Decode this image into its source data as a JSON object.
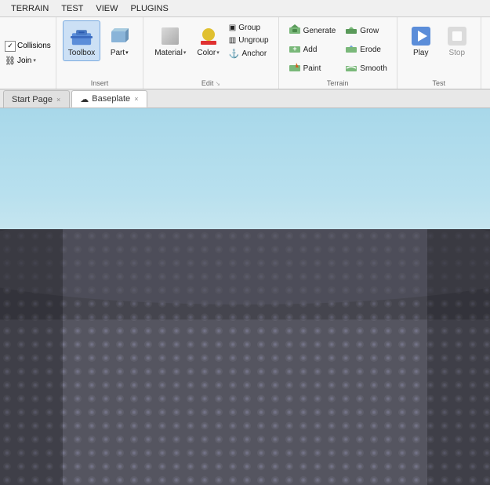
{
  "menubar": {
    "items": [
      "TERRAIN",
      "TEST",
      "VIEW",
      "PLUGINS"
    ]
  },
  "ribbon": {
    "sections": {
      "model": {
        "label": "",
        "items": [
          {
            "id": "collisions",
            "label": "Collisions",
            "type": "small-check"
          },
          {
            "id": "join",
            "label": "Join",
            "type": "small-dropdown"
          }
        ]
      },
      "insert": {
        "label": "Insert",
        "items": [
          {
            "id": "toolbox",
            "label": "Toolbox",
            "type": "large",
            "active": true
          },
          {
            "id": "part",
            "label": "Part",
            "type": "large"
          }
        ]
      },
      "edit": {
        "label": "Edit",
        "items": [
          {
            "id": "material",
            "label": "Material",
            "type": "large-dropdown"
          },
          {
            "id": "color",
            "label": "Color",
            "type": "large-dropdown"
          },
          {
            "id": "group",
            "label": "Group",
            "type": "small"
          },
          {
            "id": "ungroup",
            "label": "Ungroup",
            "type": "small"
          },
          {
            "id": "anchor",
            "label": "Anchor",
            "type": "small"
          }
        ]
      },
      "terrain": {
        "label": "Terrain",
        "items": [
          {
            "id": "generate",
            "label": "Generate",
            "type": "small-icon"
          },
          {
            "id": "add",
            "label": "Add",
            "type": "small-icon"
          },
          {
            "id": "paint",
            "label": "Paint",
            "type": "small-icon"
          },
          {
            "id": "grow",
            "label": "Grow",
            "type": "small-icon"
          },
          {
            "id": "erode",
            "label": "Erode",
            "type": "small-icon"
          },
          {
            "id": "smooth",
            "label": "Smooth",
            "type": "small-icon"
          }
        ]
      },
      "test": {
        "label": "Test",
        "items": [
          {
            "id": "play",
            "label": "Play",
            "type": "large"
          },
          {
            "id": "stop",
            "label": "Stop",
            "type": "large"
          }
        ]
      }
    }
  },
  "tabs": [
    {
      "id": "start-page",
      "label": "Start Page",
      "closable": true,
      "active": false,
      "cloud": false
    },
    {
      "id": "baseplate",
      "label": "Baseplate",
      "closable": true,
      "active": true,
      "cloud": true
    }
  ],
  "viewport": {
    "sky_color_top": "#a8d8ea",
    "sky_color_bottom": "#cde8f0",
    "ground_color": "#5a5a6a"
  },
  "icons": {
    "collisions": "☑",
    "join": "⛓",
    "toolbox": "🧰",
    "part": "📦",
    "material": "🎨",
    "color": "🎨",
    "group": "▣",
    "ungroup": "▥",
    "anchor": "⚓",
    "generate": "⚡",
    "add": "➕",
    "paint": "🖌",
    "grow": "🌱",
    "erode": "💧",
    "smooth": "〰",
    "play": "▶",
    "stop": "■",
    "cloud": "☁",
    "check": "✓",
    "dropdown": "▾",
    "close": "×",
    "expand": "↘"
  }
}
